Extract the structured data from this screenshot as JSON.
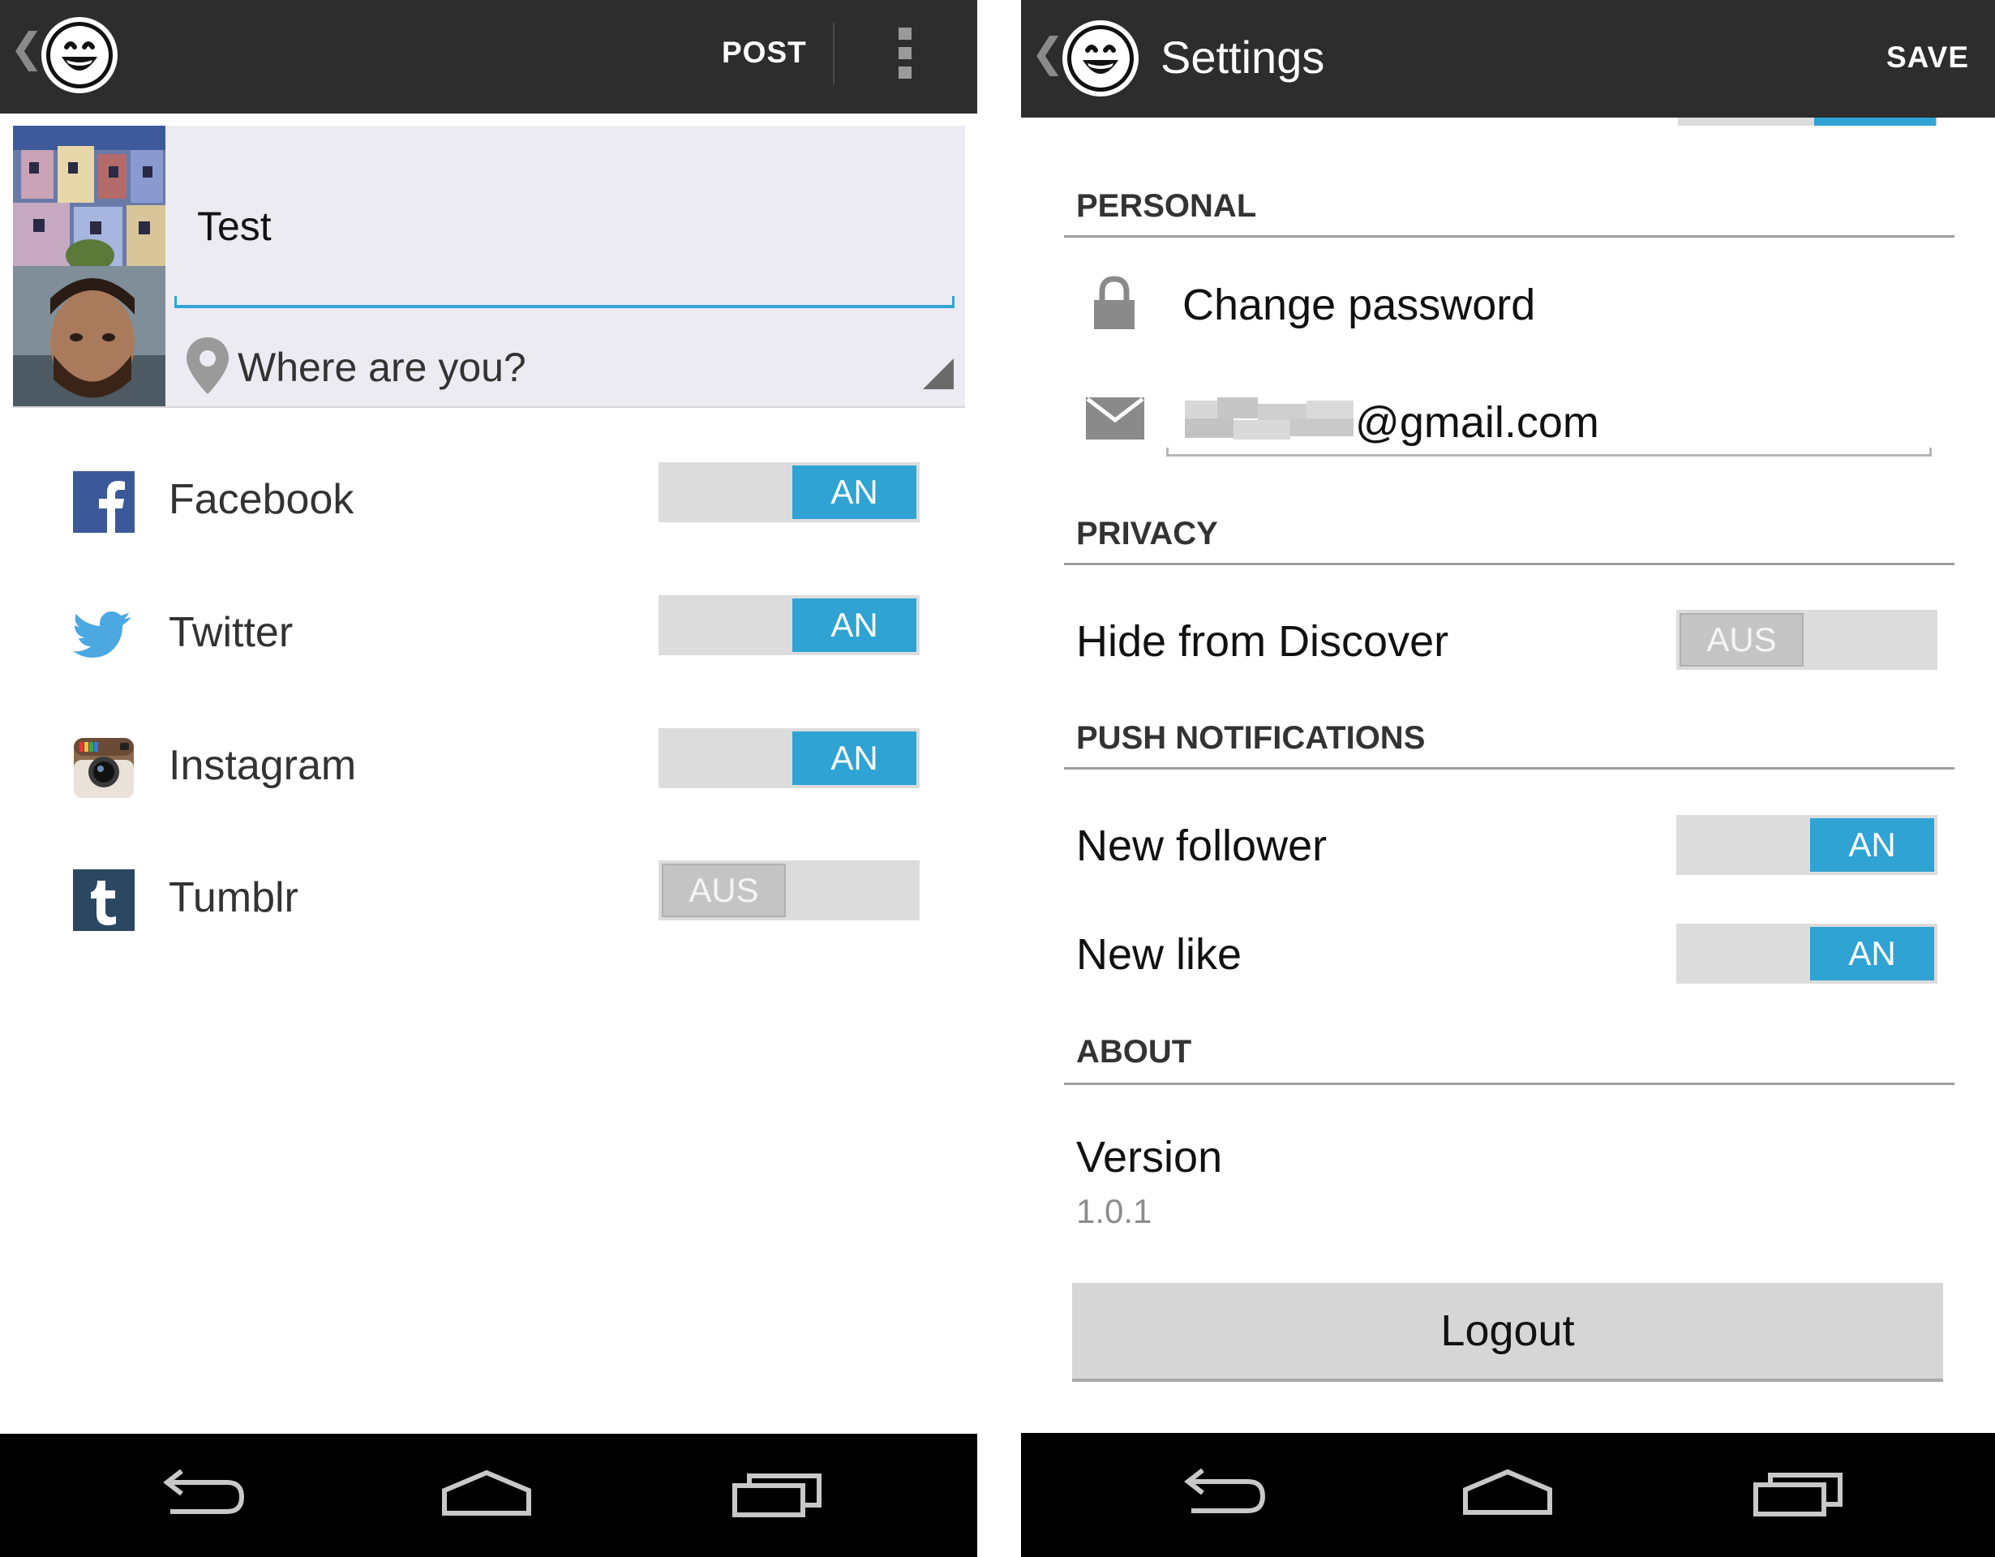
{
  "left_screen": {
    "action_bar": {
      "post_label": "POST"
    },
    "composer": {
      "text_value": "Test",
      "location_placeholder": "Where are you?"
    },
    "social_accounts": [
      {
        "name": "Facebook",
        "state": "AN",
        "on": true,
        "icon": "facebook-icon"
      },
      {
        "name": "Twitter",
        "state": "AN",
        "on": true,
        "icon": "twitter-icon"
      },
      {
        "name": "Instagram",
        "state": "AN",
        "on": true,
        "icon": "instagram-icon"
      },
      {
        "name": "Tumblr",
        "state": "AUS",
        "on": false,
        "icon": "tumblr-icon"
      }
    ]
  },
  "right_screen": {
    "action_bar": {
      "title": "Settings",
      "save_label": "SAVE"
    },
    "sections": {
      "personal": "PERSONAL",
      "privacy": "PRIVACY",
      "push": "PUSH NOTIFICATIONS",
      "about": "ABOUT"
    },
    "personal": {
      "change_password": "Change password",
      "email_suffix": "@gmail.com"
    },
    "privacy": {
      "hide_from_discover": "Hide from Discover",
      "hide_state": "AUS"
    },
    "push": {
      "new_follower": "New follower",
      "new_follower_state": "AN",
      "new_like": "New like",
      "new_like_state": "AN"
    },
    "about": {
      "version_label": "Version",
      "version_value": "1.0.1"
    },
    "logout_label": "Logout"
  },
  "colors": {
    "action_bar": "#2d2d2d",
    "accent": "#2ea3d4",
    "switch_track": "#dcdcdc",
    "nav_bar": "#000000"
  }
}
